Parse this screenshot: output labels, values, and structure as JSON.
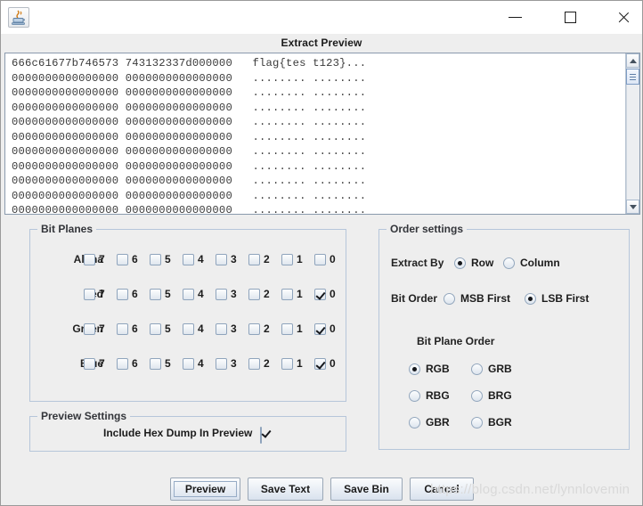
{
  "window": {
    "icon": "java-coffee-cup-icon",
    "minimize": "−",
    "maximize": "□",
    "close": "✕"
  },
  "dialog": {
    "title": "Extract Preview"
  },
  "hexdump": {
    "lines": [
      "666c61677b746573 743132337d000000   flag{tes t123}...",
      "0000000000000000 0000000000000000   ........ ........",
      "0000000000000000 0000000000000000   ........ ........",
      "0000000000000000 0000000000000000   ........ ........",
      "0000000000000000 0000000000000000   ........ ........",
      "0000000000000000 0000000000000000   ........ ........",
      "0000000000000000 0000000000000000   ........ ........",
      "0000000000000000 0000000000000000   ........ ........",
      "0000000000000000 0000000000000000   ........ ........",
      "0000000000000000 0000000000000000   ........ ........",
      "0000000000000000 0000000000000000   ........ ........"
    ],
    "scrollbar": {
      "up_arrow": "▲",
      "down_arrow": "▼"
    }
  },
  "bit_planes": {
    "title": "Bit Planes",
    "bit_labels": [
      "7",
      "6",
      "5",
      "4",
      "3",
      "2",
      "1",
      "0"
    ],
    "rows": [
      {
        "channel": "Alpha",
        "checked": [
          false,
          false,
          false,
          false,
          false,
          false,
          false,
          false
        ]
      },
      {
        "channel": "Red",
        "checked": [
          false,
          false,
          false,
          false,
          false,
          false,
          false,
          true
        ]
      },
      {
        "channel": "Green",
        "checked": [
          false,
          false,
          false,
          false,
          false,
          false,
          false,
          true
        ]
      },
      {
        "channel": "Blue",
        "checked": [
          false,
          false,
          false,
          false,
          false,
          false,
          false,
          true
        ]
      }
    ]
  },
  "order_settings": {
    "title": "Order settings",
    "extract_by": {
      "label": "Extract By",
      "options": [
        "Row",
        "Column"
      ],
      "selected": "Row"
    },
    "bit_order": {
      "label": "Bit Order",
      "options": [
        "MSB First",
        "LSB First"
      ],
      "selected": "LSB First"
    },
    "bit_plane_order": {
      "label": "Bit Plane Order",
      "options": [
        "RGB",
        "GRB",
        "RBG",
        "BRG",
        "GBR",
        "BGR"
      ],
      "selected": "RGB"
    }
  },
  "preview_settings": {
    "title": "Preview Settings",
    "include_hex_dump": {
      "label": "Include Hex Dump In Preview",
      "checked": true
    }
  },
  "buttons": {
    "preview": "Preview",
    "save_text": "Save Text",
    "save_bin": "Save Bin",
    "cancel": "Cancel"
  },
  "watermark": "https://blog.csdn.net/lynnlovemin",
  "colors": {
    "panel_bg": "#eeeeee",
    "panel_border": "#b6c6da",
    "text": "#1c1c1c",
    "hex_text": "#3a3a3a",
    "titlebar_bg": "#ffffff"
  }
}
